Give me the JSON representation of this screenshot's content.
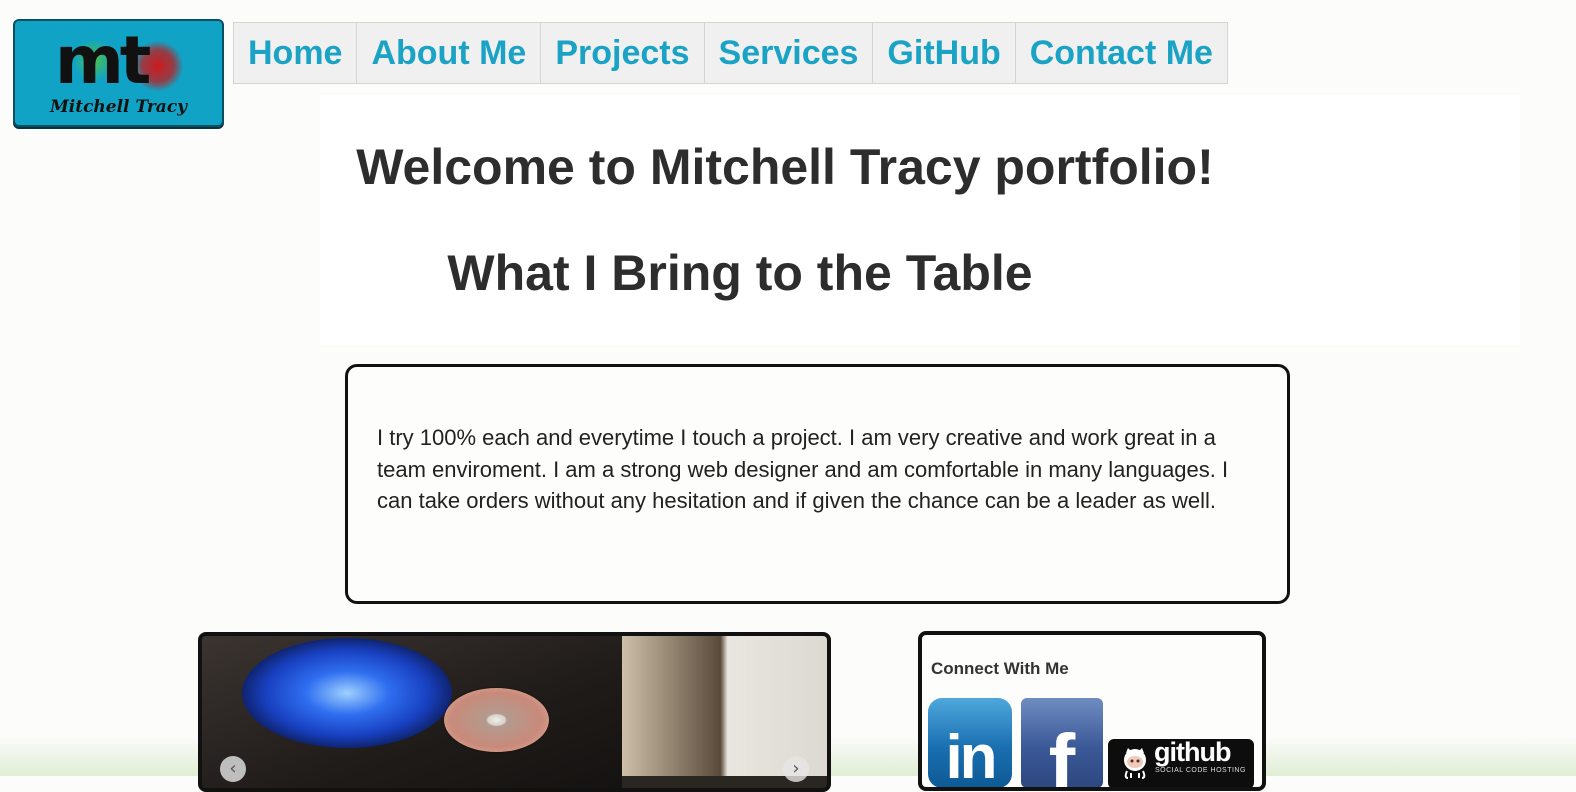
{
  "logo": {
    "monogram": "mt",
    "name": "Mitchell Tracy"
  },
  "nav": {
    "items": [
      {
        "label": "Home"
      },
      {
        "label": "About Me"
      },
      {
        "label": "Projects"
      },
      {
        "label": "Services"
      },
      {
        "label": "GitHub"
      },
      {
        "label": "Contact Me"
      }
    ],
    "text_color": "#1aa3c4",
    "background": "#f0f0f0"
  },
  "headings": {
    "welcome": "Welcome to Mitchell Tracy portfolio!",
    "bring": "What I Bring to the Table"
  },
  "about": {
    "text": "I try 100% each and everytime I touch a project. I am very creative and work great in a team enviroment. I am a strong web designer and am comfortable in many languages. I can take orders without any hesitation and if given the chance can be a leader as well."
  },
  "slider": {
    "prev_icon": "arrow-left-icon",
    "next_icon": "arrow-right-icon",
    "prev_glyph": "‹",
    "next_glyph": "›"
  },
  "connect": {
    "title": "Connect With Me",
    "linkedin": {
      "icon": "linkedin-icon",
      "glyph": "in",
      "color": "#1a6fb0"
    },
    "facebook": {
      "icon": "facebook-icon",
      "glyph": "f",
      "color": "#3b5998"
    },
    "github": {
      "icon": "github-icon",
      "text": "github",
      "subtext": "SOCIAL CODE HOSTING",
      "color": "#0d0d0d"
    }
  }
}
